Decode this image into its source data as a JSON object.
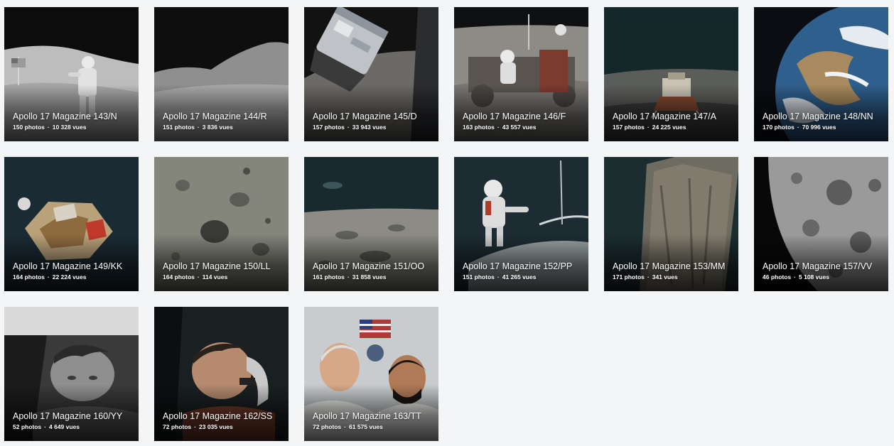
{
  "albums": [
    {
      "title": "Apollo 17 Magazine 143/N",
      "photos": "150 photos",
      "views": "10 328 vues",
      "thumb": "astronaut-flag-icon"
    },
    {
      "title": "Apollo 17 Magazine 144/R",
      "photos": "151 photos",
      "views": "3 836 vues",
      "thumb": "lunar-hills-icon"
    },
    {
      "title": "Apollo 17 Magazine 145/D",
      "photos": "157 photos",
      "views": "33 943 vues",
      "thumb": "command-module-icon"
    },
    {
      "title": "Apollo 17 Magazine 146/F",
      "photos": "163 photos",
      "views": "43 557 vues",
      "thumb": "lunar-rover-icon"
    },
    {
      "title": "Apollo 17 Magazine 147/A",
      "photos": "157 photos",
      "views": "24 225 vues",
      "thumb": "lunar-module-icon"
    },
    {
      "title": "Apollo 17 Magazine 148/NN",
      "photos": "170 photos",
      "views": "70 996 vues",
      "thumb": "earth-icon"
    },
    {
      "title": "Apollo 17 Magazine 149/KK",
      "photos": "164 photos",
      "views": "22 224 vues",
      "thumb": "lunar-module-ascent-icon"
    },
    {
      "title": "Apollo 17 Magazine 150/LL",
      "photos": "164 photos",
      "views": "114 vues",
      "thumb": "crater-surface-icon"
    },
    {
      "title": "Apollo 17 Magazine 151/OO",
      "photos": "161 photos",
      "views": "31 858 vues",
      "thumb": "lunar-horizon-icon"
    },
    {
      "title": "Apollo 17 Magazine 152/PP",
      "photos": "151 photos",
      "views": "41 265 vues",
      "thumb": "spacewalk-icon"
    },
    {
      "title": "Apollo 17 Magazine 153/MM",
      "photos": "171 photos",
      "views": "341 vues",
      "thumb": "lunar-strip-icon"
    },
    {
      "title": "Apollo 17 Magazine 157/VV",
      "photos": "46 photos",
      "views": "5 108 vues",
      "thumb": "moon-closeup-icon"
    },
    {
      "title": "Apollo 17 Magazine 160/YY",
      "photos": "52 photos",
      "views": "4 649 vues",
      "thumb": "astronaut-portrait-bw-icon"
    },
    {
      "title": "Apollo 17 Magazine 162/SS",
      "photos": "72 photos",
      "views": "23 035 vues",
      "thumb": "astronaut-helmet-icon"
    },
    {
      "title": "Apollo 17 Magazine 163/TT",
      "photos": "72 photos",
      "views": "61 575 vues",
      "thumb": "crew-portrait-icon"
    }
  ],
  "separator": "·"
}
